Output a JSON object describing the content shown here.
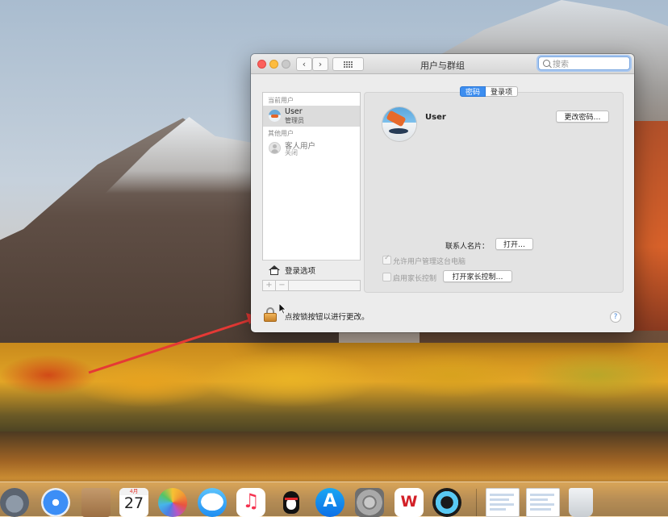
{
  "window": {
    "title": "用户与群组",
    "search_placeholder": "搜索",
    "nav_back": "‹",
    "nav_forward": "›"
  },
  "sidebar": {
    "current_users_label": "当前用户",
    "other_users_label": "其他用户",
    "current_user": {
      "name": "User",
      "role": "管理员"
    },
    "guest_user": {
      "name": "客人用户",
      "status": "关闭"
    },
    "login_options": "登录选项",
    "add_label": "+",
    "remove_label": "−"
  },
  "tabs": [
    {
      "label": "密码",
      "active": true
    },
    {
      "label": "登录项",
      "active": false
    }
  ],
  "detail": {
    "username": "User",
    "change_password_button": "更改密码…",
    "contact_card_label": "联系人名片：",
    "open_button": "打开…",
    "allow_admin_label": "允许用户管理这台电脑",
    "allow_admin_checked": true,
    "parental_controls_label": "启用家长控制",
    "parental_controls_checked": false,
    "open_parental_controls_button": "打开家长控制…"
  },
  "footer": {
    "lock_text": "点按锁按钮以进行更改。",
    "help_label": "?"
  },
  "dock": {
    "calendar_month": "4月",
    "calendar_day": "27",
    "wps_label": "W",
    "appstore_label": "A",
    "items": [
      "launchpad-icon",
      "safari-icon",
      "notes-icon",
      "calendar-icon",
      "photos-icon",
      "messages-icon",
      "music-icon",
      "qq-icon",
      "appstore-icon",
      "system-preferences-icon",
      "wps-icon",
      "quicktime-icon",
      "document-icon",
      "document-icon",
      "trash-icon"
    ]
  },
  "colors": {
    "accent": "#3d8ef0",
    "close": "#fc605c",
    "minimize": "#fdbc40",
    "annotation_arrow": "#e53935"
  }
}
